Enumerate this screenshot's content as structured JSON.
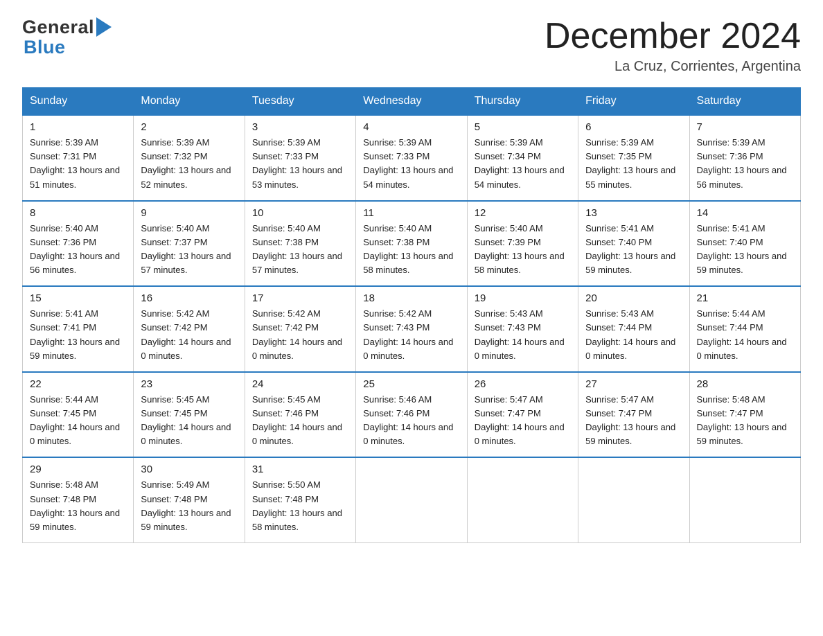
{
  "header": {
    "month": "December 2024",
    "location": "La Cruz, Corrientes, Argentina",
    "logo_general": "General",
    "logo_blue": "Blue"
  },
  "days_of_week": [
    "Sunday",
    "Monday",
    "Tuesday",
    "Wednesday",
    "Thursday",
    "Friday",
    "Saturday"
  ],
  "weeks": [
    [
      {
        "day": "1",
        "sunrise": "5:39 AM",
        "sunset": "7:31 PM",
        "daylight": "13 hours and 51 minutes."
      },
      {
        "day": "2",
        "sunrise": "5:39 AM",
        "sunset": "7:32 PM",
        "daylight": "13 hours and 52 minutes."
      },
      {
        "day": "3",
        "sunrise": "5:39 AM",
        "sunset": "7:33 PM",
        "daylight": "13 hours and 53 minutes."
      },
      {
        "day": "4",
        "sunrise": "5:39 AM",
        "sunset": "7:33 PM",
        "daylight": "13 hours and 54 minutes."
      },
      {
        "day": "5",
        "sunrise": "5:39 AM",
        "sunset": "7:34 PM",
        "daylight": "13 hours and 54 minutes."
      },
      {
        "day": "6",
        "sunrise": "5:39 AM",
        "sunset": "7:35 PM",
        "daylight": "13 hours and 55 minutes."
      },
      {
        "day": "7",
        "sunrise": "5:39 AM",
        "sunset": "7:36 PM",
        "daylight": "13 hours and 56 minutes."
      }
    ],
    [
      {
        "day": "8",
        "sunrise": "5:40 AM",
        "sunset": "7:36 PM",
        "daylight": "13 hours and 56 minutes."
      },
      {
        "day": "9",
        "sunrise": "5:40 AM",
        "sunset": "7:37 PM",
        "daylight": "13 hours and 57 minutes."
      },
      {
        "day": "10",
        "sunrise": "5:40 AM",
        "sunset": "7:38 PM",
        "daylight": "13 hours and 57 minutes."
      },
      {
        "day": "11",
        "sunrise": "5:40 AM",
        "sunset": "7:38 PM",
        "daylight": "13 hours and 58 minutes."
      },
      {
        "day": "12",
        "sunrise": "5:40 AM",
        "sunset": "7:39 PM",
        "daylight": "13 hours and 58 minutes."
      },
      {
        "day": "13",
        "sunrise": "5:41 AM",
        "sunset": "7:40 PM",
        "daylight": "13 hours and 59 minutes."
      },
      {
        "day": "14",
        "sunrise": "5:41 AM",
        "sunset": "7:40 PM",
        "daylight": "13 hours and 59 minutes."
      }
    ],
    [
      {
        "day": "15",
        "sunrise": "5:41 AM",
        "sunset": "7:41 PM",
        "daylight": "13 hours and 59 minutes."
      },
      {
        "day": "16",
        "sunrise": "5:42 AM",
        "sunset": "7:42 PM",
        "daylight": "14 hours and 0 minutes."
      },
      {
        "day": "17",
        "sunrise": "5:42 AM",
        "sunset": "7:42 PM",
        "daylight": "14 hours and 0 minutes."
      },
      {
        "day": "18",
        "sunrise": "5:42 AM",
        "sunset": "7:43 PM",
        "daylight": "14 hours and 0 minutes."
      },
      {
        "day": "19",
        "sunrise": "5:43 AM",
        "sunset": "7:43 PM",
        "daylight": "14 hours and 0 minutes."
      },
      {
        "day": "20",
        "sunrise": "5:43 AM",
        "sunset": "7:44 PM",
        "daylight": "14 hours and 0 minutes."
      },
      {
        "day": "21",
        "sunrise": "5:44 AM",
        "sunset": "7:44 PM",
        "daylight": "14 hours and 0 minutes."
      }
    ],
    [
      {
        "day": "22",
        "sunrise": "5:44 AM",
        "sunset": "7:45 PM",
        "daylight": "14 hours and 0 minutes."
      },
      {
        "day": "23",
        "sunrise": "5:45 AM",
        "sunset": "7:45 PM",
        "daylight": "14 hours and 0 minutes."
      },
      {
        "day": "24",
        "sunrise": "5:45 AM",
        "sunset": "7:46 PM",
        "daylight": "14 hours and 0 minutes."
      },
      {
        "day": "25",
        "sunrise": "5:46 AM",
        "sunset": "7:46 PM",
        "daylight": "14 hours and 0 minutes."
      },
      {
        "day": "26",
        "sunrise": "5:47 AM",
        "sunset": "7:47 PM",
        "daylight": "14 hours and 0 minutes."
      },
      {
        "day": "27",
        "sunrise": "5:47 AM",
        "sunset": "7:47 PM",
        "daylight": "13 hours and 59 minutes."
      },
      {
        "day": "28",
        "sunrise": "5:48 AM",
        "sunset": "7:47 PM",
        "daylight": "13 hours and 59 minutes."
      }
    ],
    [
      {
        "day": "29",
        "sunrise": "5:48 AM",
        "sunset": "7:48 PM",
        "daylight": "13 hours and 59 minutes."
      },
      {
        "day": "30",
        "sunrise": "5:49 AM",
        "sunset": "7:48 PM",
        "daylight": "13 hours and 59 minutes."
      },
      {
        "day": "31",
        "sunrise": "5:50 AM",
        "sunset": "7:48 PM",
        "daylight": "13 hours and 58 minutes."
      },
      null,
      null,
      null,
      null
    ]
  ]
}
